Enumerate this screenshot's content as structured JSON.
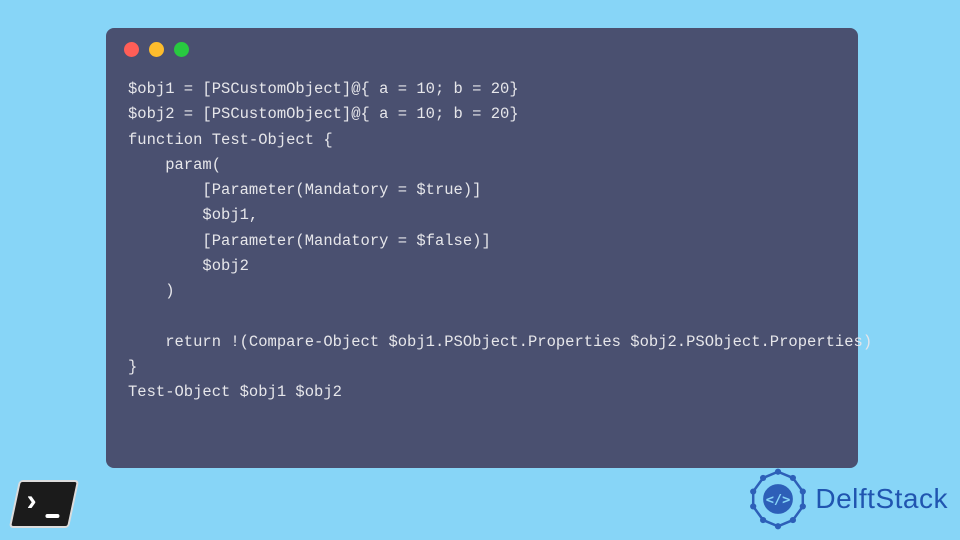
{
  "code": {
    "lines": [
      "$obj1 = [PSCustomObject]@{ a = 10; b = 20}",
      "$obj2 = [PSCustomObject]@{ a = 10; b = 20}",
      "function Test-Object {",
      "    param(",
      "        [Parameter(Mandatory = $true)]",
      "        $obj1,",
      "        [Parameter(Mandatory = $false)]",
      "        $obj2",
      "    )",
      "",
      "    return !(Compare-Object $obj1.PSObject.Properties $obj2.PSObject.Properties)",
      "}",
      "Test-Object $obj1 $obj2"
    ]
  },
  "brand": {
    "name": "DelftStack"
  }
}
